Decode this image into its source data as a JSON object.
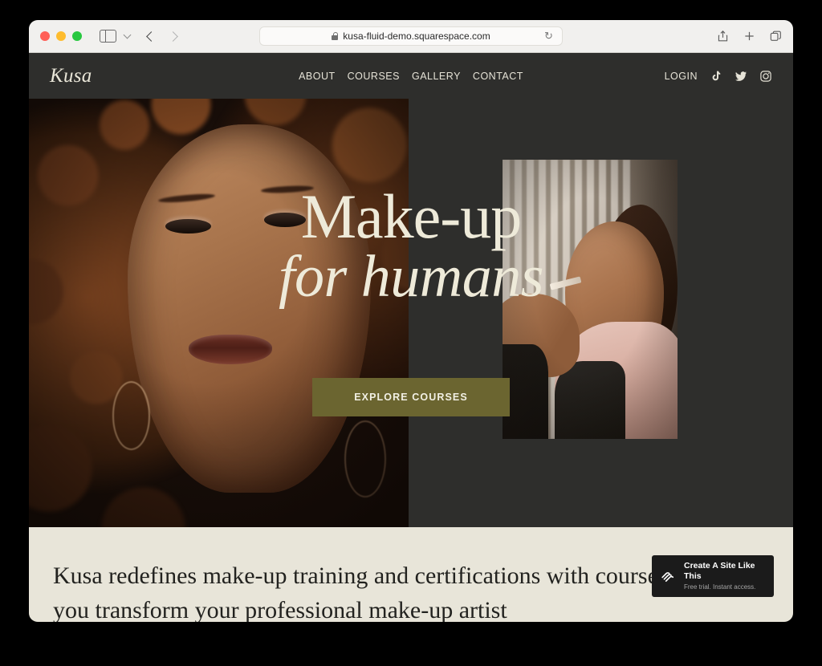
{
  "browser": {
    "url": "kusa-fluid-demo.squarespace.com",
    "lock_icon": "lock-icon",
    "reload_icon": "reload-icon",
    "sidebar_icon": "sidebar-toggle-icon",
    "chevron_icon": "chevron-down-icon",
    "back_icon": "back-arrow-icon",
    "forward_icon": "forward-arrow-icon",
    "share_icon": "share-icon",
    "new_tab_icon": "plus-icon",
    "tabs_icon": "tab-overview-icon",
    "traffic_lights": [
      "close",
      "minimize",
      "maximize"
    ]
  },
  "site": {
    "logo": "Kusa",
    "nav": [
      {
        "label": "ABOUT"
      },
      {
        "label": "COURSES"
      },
      {
        "label": "GALLERY"
      },
      {
        "label": "CONTACT"
      }
    ],
    "login_label": "LOGIN",
    "social": [
      {
        "name": "tiktok-icon"
      },
      {
        "name": "twitter-icon"
      },
      {
        "name": "instagram-icon"
      }
    ],
    "hero": {
      "headline_line1": "Make-up",
      "headline_line2": "for humans",
      "cta_label": "EXPLORE COURSES",
      "image_left_alt": "portrait-of-woman-with-curly-hair",
      "image_right_alt": "makeup-artist-applying-eyeshadow"
    },
    "intro": {
      "paragraph": "Kusa redefines make-up training and certifications with courses to help you transform your professional make-up artist"
    }
  },
  "badge": {
    "logo_icon": "squarespace-logo-icon",
    "title": "Create A Site Like This",
    "subtitle": "Free trial. Instant access."
  },
  "colors": {
    "site_dark": "#2e2e2c",
    "cream": "#e8e5d9",
    "olive_accent": "#6b6530",
    "text_cream": "#e9e6d8",
    "badge_dark": "#1b1b1b"
  }
}
